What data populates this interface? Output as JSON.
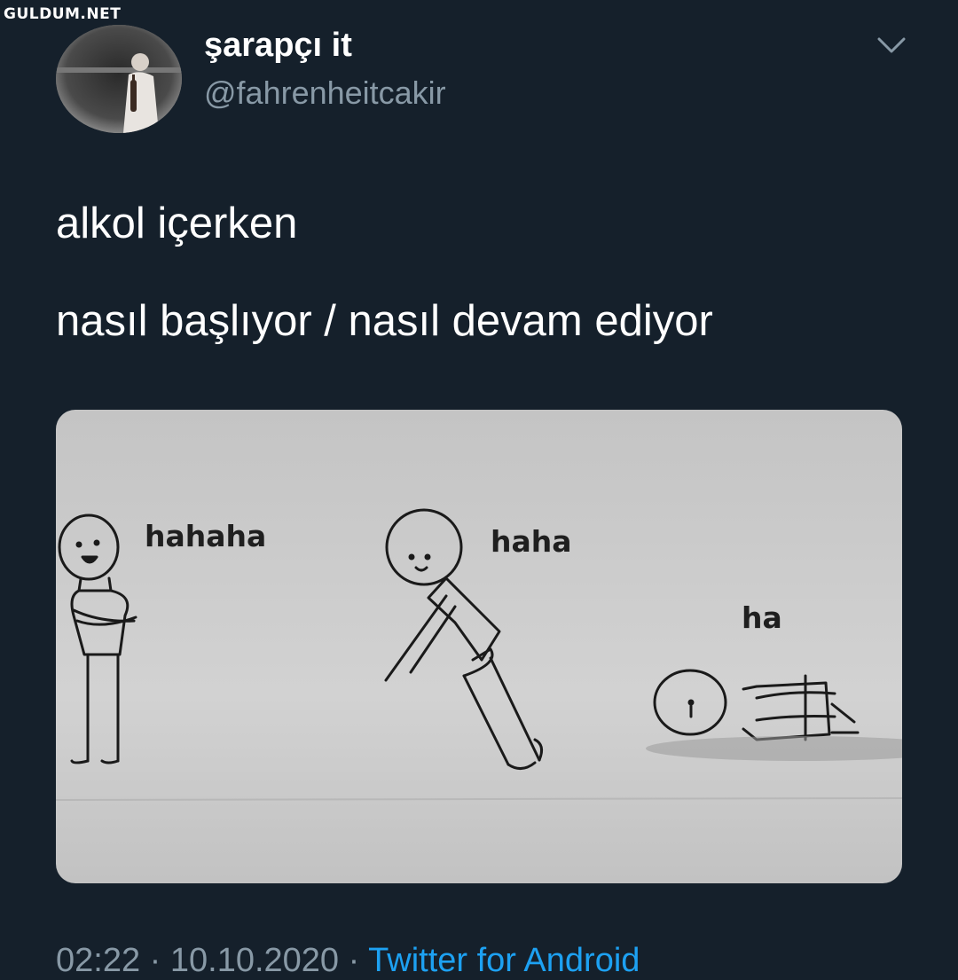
{
  "watermark": "GULDUM.NET",
  "tweet": {
    "display_name": "şarapçı it",
    "handle": "@fahrenheitcakir",
    "text_lines": [
      "alkol içerken",
      "nasıl başlıyor / nasıl devam ediyor"
    ],
    "timestamp": "02:22 · 10.10.2020",
    "separator": " · ",
    "source": "Twitter for Android"
  },
  "media": {
    "captions": [
      "hahaha",
      "haha",
      "ha"
    ]
  },
  "icons": {
    "menu": "chevron-down-icon"
  },
  "colors": {
    "background": "#15202b",
    "secondary_text": "#8899a6",
    "link": "#1da1f2"
  }
}
